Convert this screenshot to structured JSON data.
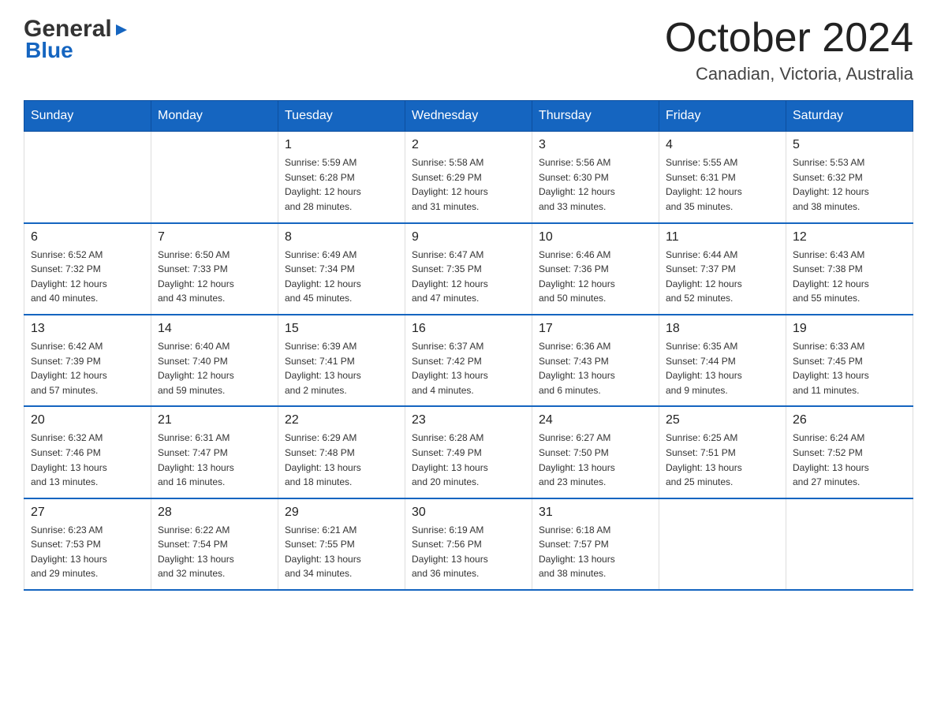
{
  "logo": {
    "general": "General",
    "blue": "Blue",
    "triangle_char": "▶"
  },
  "title": {
    "month_year": "October 2024",
    "location": "Canadian, Victoria, Australia"
  },
  "weekdays": [
    "Sunday",
    "Monday",
    "Tuesday",
    "Wednesday",
    "Thursday",
    "Friday",
    "Saturday"
  ],
  "weeks": [
    [
      {
        "day": "",
        "info": ""
      },
      {
        "day": "",
        "info": ""
      },
      {
        "day": "1",
        "info": "Sunrise: 5:59 AM\nSunset: 6:28 PM\nDaylight: 12 hours\nand 28 minutes."
      },
      {
        "day": "2",
        "info": "Sunrise: 5:58 AM\nSunset: 6:29 PM\nDaylight: 12 hours\nand 31 minutes."
      },
      {
        "day": "3",
        "info": "Sunrise: 5:56 AM\nSunset: 6:30 PM\nDaylight: 12 hours\nand 33 minutes."
      },
      {
        "day": "4",
        "info": "Sunrise: 5:55 AM\nSunset: 6:31 PM\nDaylight: 12 hours\nand 35 minutes."
      },
      {
        "day": "5",
        "info": "Sunrise: 5:53 AM\nSunset: 6:32 PM\nDaylight: 12 hours\nand 38 minutes."
      }
    ],
    [
      {
        "day": "6",
        "info": "Sunrise: 6:52 AM\nSunset: 7:32 PM\nDaylight: 12 hours\nand 40 minutes."
      },
      {
        "day": "7",
        "info": "Sunrise: 6:50 AM\nSunset: 7:33 PM\nDaylight: 12 hours\nand 43 minutes."
      },
      {
        "day": "8",
        "info": "Sunrise: 6:49 AM\nSunset: 7:34 PM\nDaylight: 12 hours\nand 45 minutes."
      },
      {
        "day": "9",
        "info": "Sunrise: 6:47 AM\nSunset: 7:35 PM\nDaylight: 12 hours\nand 47 minutes."
      },
      {
        "day": "10",
        "info": "Sunrise: 6:46 AM\nSunset: 7:36 PM\nDaylight: 12 hours\nand 50 minutes."
      },
      {
        "day": "11",
        "info": "Sunrise: 6:44 AM\nSunset: 7:37 PM\nDaylight: 12 hours\nand 52 minutes."
      },
      {
        "day": "12",
        "info": "Sunrise: 6:43 AM\nSunset: 7:38 PM\nDaylight: 12 hours\nand 55 minutes."
      }
    ],
    [
      {
        "day": "13",
        "info": "Sunrise: 6:42 AM\nSunset: 7:39 PM\nDaylight: 12 hours\nand 57 minutes."
      },
      {
        "day": "14",
        "info": "Sunrise: 6:40 AM\nSunset: 7:40 PM\nDaylight: 12 hours\nand 59 minutes."
      },
      {
        "day": "15",
        "info": "Sunrise: 6:39 AM\nSunset: 7:41 PM\nDaylight: 13 hours\nand 2 minutes."
      },
      {
        "day": "16",
        "info": "Sunrise: 6:37 AM\nSunset: 7:42 PM\nDaylight: 13 hours\nand 4 minutes."
      },
      {
        "day": "17",
        "info": "Sunrise: 6:36 AM\nSunset: 7:43 PM\nDaylight: 13 hours\nand 6 minutes."
      },
      {
        "day": "18",
        "info": "Sunrise: 6:35 AM\nSunset: 7:44 PM\nDaylight: 13 hours\nand 9 minutes."
      },
      {
        "day": "19",
        "info": "Sunrise: 6:33 AM\nSunset: 7:45 PM\nDaylight: 13 hours\nand 11 minutes."
      }
    ],
    [
      {
        "day": "20",
        "info": "Sunrise: 6:32 AM\nSunset: 7:46 PM\nDaylight: 13 hours\nand 13 minutes."
      },
      {
        "day": "21",
        "info": "Sunrise: 6:31 AM\nSunset: 7:47 PM\nDaylight: 13 hours\nand 16 minutes."
      },
      {
        "day": "22",
        "info": "Sunrise: 6:29 AM\nSunset: 7:48 PM\nDaylight: 13 hours\nand 18 minutes."
      },
      {
        "day": "23",
        "info": "Sunrise: 6:28 AM\nSunset: 7:49 PM\nDaylight: 13 hours\nand 20 minutes."
      },
      {
        "day": "24",
        "info": "Sunrise: 6:27 AM\nSunset: 7:50 PM\nDaylight: 13 hours\nand 23 minutes."
      },
      {
        "day": "25",
        "info": "Sunrise: 6:25 AM\nSunset: 7:51 PM\nDaylight: 13 hours\nand 25 minutes."
      },
      {
        "day": "26",
        "info": "Sunrise: 6:24 AM\nSunset: 7:52 PM\nDaylight: 13 hours\nand 27 minutes."
      }
    ],
    [
      {
        "day": "27",
        "info": "Sunrise: 6:23 AM\nSunset: 7:53 PM\nDaylight: 13 hours\nand 29 minutes."
      },
      {
        "day": "28",
        "info": "Sunrise: 6:22 AM\nSunset: 7:54 PM\nDaylight: 13 hours\nand 32 minutes."
      },
      {
        "day": "29",
        "info": "Sunrise: 6:21 AM\nSunset: 7:55 PM\nDaylight: 13 hours\nand 34 minutes."
      },
      {
        "day": "30",
        "info": "Sunrise: 6:19 AM\nSunset: 7:56 PM\nDaylight: 13 hours\nand 36 minutes."
      },
      {
        "day": "31",
        "info": "Sunrise: 6:18 AM\nSunset: 7:57 PM\nDaylight: 13 hours\nand 38 minutes."
      },
      {
        "day": "",
        "info": ""
      },
      {
        "day": "",
        "info": ""
      }
    ]
  ]
}
